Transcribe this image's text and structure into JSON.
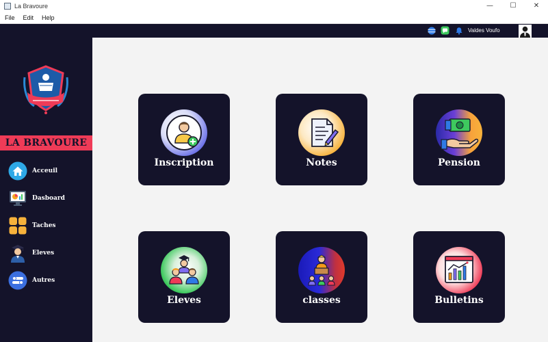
{
  "window": {
    "title": "La Bravoure",
    "controls": {
      "minimize": "—",
      "maximize": "☐",
      "close": "✕"
    }
  },
  "menubar": {
    "items": [
      "File",
      "Edit",
      "Help"
    ]
  },
  "header": {
    "icons": [
      "globe-icon",
      "chat-icon",
      "bell-icon"
    ],
    "username": "Valdes Voufo"
  },
  "sidebar": {
    "brand": "LA BRAVOURE",
    "logo_text": "LA BRAVOURE",
    "items": [
      {
        "label": "Acceuil",
        "icon": "home-icon"
      },
      {
        "label": "Dasboard",
        "icon": "dashboard-icon"
      },
      {
        "label": "Taches",
        "icon": "tasks-icon"
      },
      {
        "label": "Eleves",
        "icon": "student-icon"
      },
      {
        "label": "Autres",
        "icon": "toggle-icon"
      }
    ]
  },
  "cards": [
    {
      "label": "Inscription",
      "icon": "add-user-icon"
    },
    {
      "label": "Notes",
      "icon": "document-pen-icon"
    },
    {
      "label": "Pension",
      "icon": "money-hand-icon"
    },
    {
      "label": "Eleves",
      "icon": "students-group-icon"
    },
    {
      "label": "classes",
      "icon": "classroom-icon"
    },
    {
      "label": "Bulletins",
      "icon": "report-chart-icon"
    }
  ],
  "colors": {
    "dark": "#14132a",
    "brand_red": "#ef3b57",
    "background": "#f3f3f3"
  }
}
